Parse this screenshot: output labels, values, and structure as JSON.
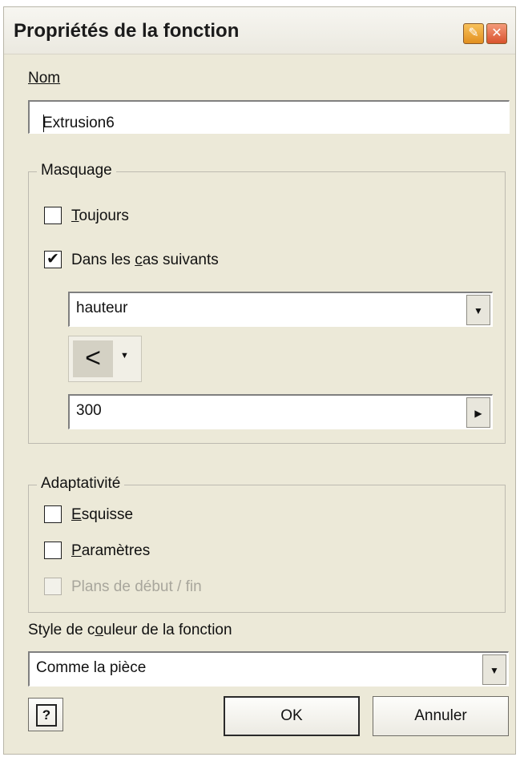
{
  "window": {
    "title": "Propriétés de la fonction",
    "pin_glyph": "✎",
    "close_glyph": "✕"
  },
  "name_field": {
    "label": "Nom",
    "value": "Extrusion6"
  },
  "masquage": {
    "legend": "Masquage",
    "toujours": {
      "label": "Toujours",
      "checked": false
    },
    "dans_les_cas": {
      "label": "Dans les cas suivants",
      "checked": true,
      "mark": "✔"
    },
    "parameter": "hauteur",
    "operator": "<",
    "operator_arrow": "▼",
    "value": "300"
  },
  "adaptativite": {
    "legend": "Adaptativité",
    "esquisse": {
      "label": "Esquisse",
      "checked": false
    },
    "parametres": {
      "label": "Paramètres",
      "checked": false
    },
    "plans": {
      "label": "Plans de début / fin",
      "checked": false,
      "disabled": true
    }
  },
  "color_style": {
    "label": "Style de couleur de la fonction",
    "value": "Comme la pièce"
  },
  "buttons": {
    "help": "?",
    "ok": "OK",
    "cancel": "Annuler"
  },
  "icons": {
    "dropdown": "▼",
    "spin_right": "▶"
  }
}
